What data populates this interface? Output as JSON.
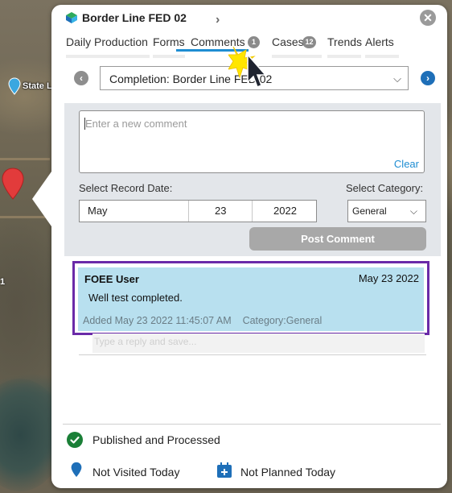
{
  "map": {
    "marker_label": "State L",
    "edge_label": "1"
  },
  "popup": {
    "title": "Border Line FED 02",
    "next_glyph": "›",
    "close_glyph": "✕",
    "tabs": [
      {
        "label": "Daily Production",
        "active": false
      },
      {
        "label": "Forms",
        "active": false
      },
      {
        "label": "Comments",
        "active": true,
        "badge": "1"
      },
      {
        "label": "Cases",
        "active": false,
        "badge": "12"
      },
      {
        "label": "Trends",
        "active": false
      },
      {
        "label": "Alerts",
        "active": false
      }
    ],
    "completion_select": {
      "value": "Completion:  Border Line FED 02"
    },
    "comment_form": {
      "placeholder": "Enter a new comment",
      "clear_label": "Clear",
      "record_date_label": "Select Record Date:",
      "category_label": "Select Category:",
      "date": {
        "month": "May",
        "day": "23",
        "year": "2022"
      },
      "category_value": "General",
      "post_label": "Post Comment"
    },
    "comments": [
      {
        "user": "FOEE User",
        "date": "May 23 2022",
        "text": "Well test completed.",
        "added_label": "Added",
        "added_value": "May 23 2022 11:45:07 AM",
        "category_label": "Category:",
        "category_value": "General"
      }
    ],
    "reply_placeholder": "Type a reply and save...",
    "status": {
      "processed": "Published and Processed",
      "visited": "Not Visited Today",
      "planned": "Not Planned Today"
    }
  },
  "colors": {
    "accent": "#1e8dd2",
    "highlight_outline": "#6a2aa8",
    "comment_bg": "#b8e0ef",
    "success": "#1a7f37",
    "status_blue": "#1e6fb8"
  }
}
